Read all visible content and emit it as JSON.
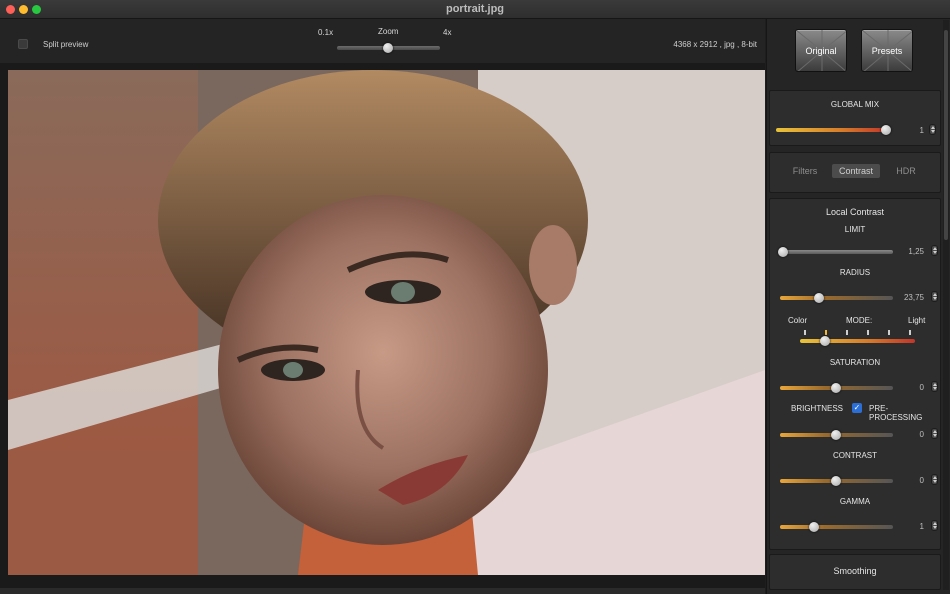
{
  "window": {
    "title": "portrait.jpg"
  },
  "toolbar": {
    "split_preview_label": "Split preview",
    "split_preview_checked": false,
    "zoom_min_label": "0.1x",
    "zoom_title": "Zoom",
    "zoom_max_label": "4x",
    "zoom_level_fraction": 0.5,
    "image_info": "4368 x 2912 , jpg , 8-bit"
  },
  "preset_buttons": {
    "original_label": "Original",
    "presets_label": "Presets"
  },
  "global_mix": {
    "title": "GLOBAL MIX",
    "value": "1",
    "fraction": 1.0
  },
  "tabs": {
    "filters": "Filters",
    "contrast": "Contrast",
    "hdr": "HDR",
    "selected": "Contrast"
  },
  "local_contrast": {
    "title": "Local Contrast",
    "limit": {
      "label": "LIMIT",
      "value": "1,25"
    },
    "radius": {
      "label": "RADIUS",
      "value": "23,75"
    },
    "mode": {
      "left_label": "Color",
      "label": "MODE:",
      "right_label": "Light",
      "positions": 6,
      "selected_index": 1
    },
    "saturation": {
      "label": "SATURATION",
      "value": "0"
    },
    "brightness": {
      "label": "BRIGHTNESS"
    },
    "pre_processing": {
      "label": "PRE-PROCESSING",
      "checked": true,
      "value": "0"
    },
    "contrast": {
      "label": "CONTRAST",
      "value": "0"
    },
    "gamma": {
      "label": "GAMMA",
      "value": "1"
    }
  },
  "smoothing": {
    "title": "Smoothing"
  },
  "colors": {
    "accent_orange": "#e9a63a",
    "checkbox_blue": "#2b6fd6",
    "close": "#fe5f57",
    "minimize": "#febc2e",
    "maximize": "#28c840"
  },
  "icons": [
    "close-icon",
    "minimize-icon",
    "maximize-icon",
    "checkmark-icon",
    "stepper-icon"
  ]
}
